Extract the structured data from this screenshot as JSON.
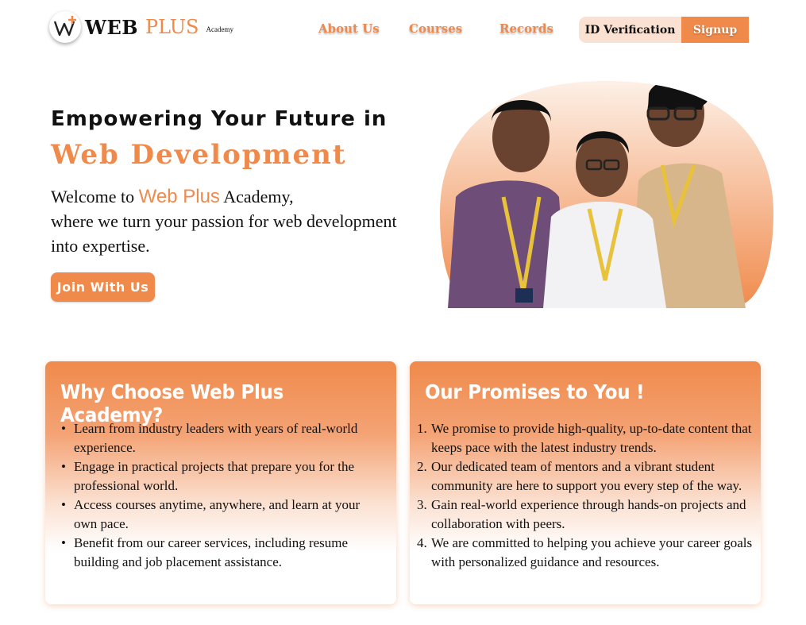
{
  "header": {
    "logo": {
      "web": "WEB",
      "plus": "PLUS",
      "academy": "Academy"
    },
    "nav": [
      "About Us",
      "Courses",
      "Records"
    ],
    "id_verification": "ID Verification",
    "signup": "Signup"
  },
  "hero": {
    "title_line1": "Empowering Your Future in",
    "title_line2": "Web Development",
    "welcome_pre": "Welcome to",
    "welcome_brand": "Web Plus",
    "welcome_post": "Academy,",
    "line2": "where we turn your passion for web development",
    "line3": "into expertise.",
    "cta": "Join With Us"
  },
  "why": {
    "title": "Why Choose Web Plus Academy?",
    "items": [
      [
        "Learn from industry leaders with years of real-world",
        "experience."
      ],
      [
        "Engage in practical projects that prepare you for the",
        "professional world."
      ],
      [
        "Access courses anytime, anywhere, and learn at your",
        "own pace."
      ],
      [
        "Benefit from our career services, including resume",
        "building and job placement assistance."
      ]
    ]
  },
  "promises": {
    "title": "Our Promises to You !",
    "items": [
      [
        "We promise to provide high-quality, up-to-date content that",
        "keeps pace with the latest industry trends."
      ],
      [
        "Our dedicated team of mentors and a vibrant student",
        "community are here to support you every step of the way."
      ],
      [
        "Gain real-world experience through hands-on projects and",
        "collaboration with peers."
      ],
      [
        " We are committed to helping you achieve your career goals",
        "with personalized guidance and resources."
      ]
    ],
    "numbers": [
      "1.",
      "2.",
      "3.",
      "4."
    ]
  },
  "colors": {
    "accent": "#ef8a4b",
    "accent_light": "#fbe1d1",
    "text": "#111111"
  },
  "icons": {
    "logo": "w-plus-logo-icon"
  }
}
